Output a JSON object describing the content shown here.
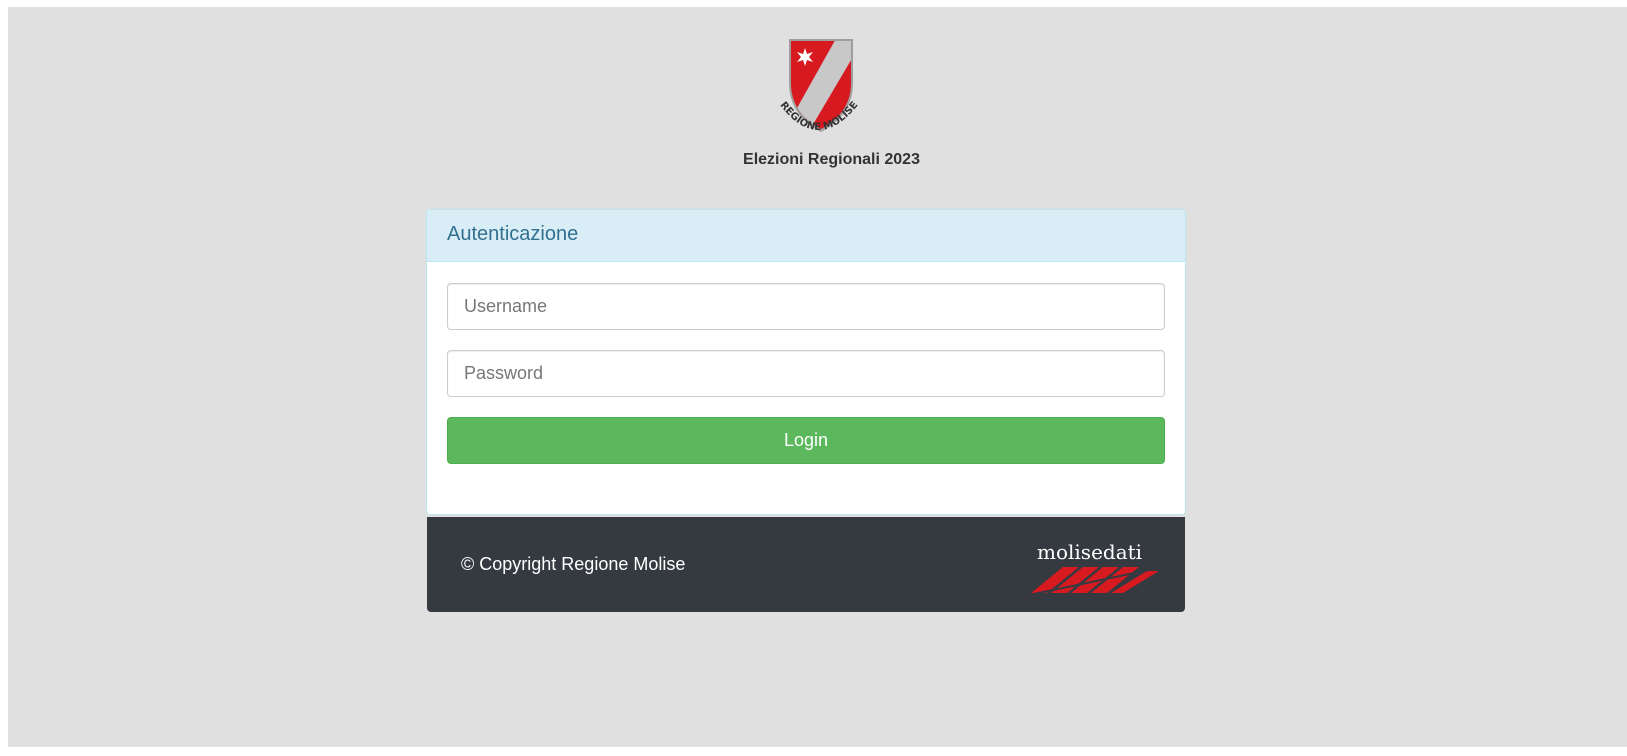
{
  "header": {
    "logo_text": "REGIONE MOLISE",
    "title": "Elezioni Regionali 2023"
  },
  "login_panel": {
    "heading": "Autenticazione",
    "username_placeholder": "Username",
    "password_placeholder": "Password",
    "login_label": "Login"
  },
  "footer": {
    "copyright": "© Copyright Regione Molise",
    "partner_logo_text": "molisedati"
  },
  "colors": {
    "background": "#e0e0e0",
    "panel_heading_bg": "#d9edf7",
    "panel_heading_text": "#31708f",
    "login_button": "#5cb85c",
    "footer_bg": "#343a40",
    "logo_red": "#d71920"
  }
}
